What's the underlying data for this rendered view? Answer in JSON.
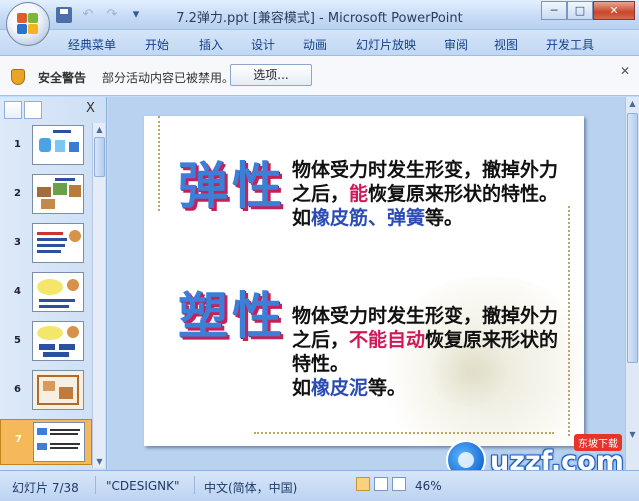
{
  "window": {
    "title": "7.2弹力.ppt [兼容模式] - Microsoft PowerPoint",
    "controls": [
      "─",
      "□",
      "✕"
    ]
  },
  "ribbon": {
    "tabs": [
      "经典菜单",
      "开始",
      "插入",
      "设计",
      "动画",
      "幻灯片放映",
      "审阅",
      "视图",
      "开发工具"
    ]
  },
  "security": {
    "title": "安全警告",
    "message": "部分活动内容已被禁用。",
    "options_button": "选项...",
    "close": "✕"
  },
  "left_panel": {
    "close": "X",
    "slides": [
      {
        "num": "1"
      },
      {
        "num": "2"
      },
      {
        "num": "3"
      },
      {
        "num": "4"
      },
      {
        "num": "5"
      },
      {
        "num": "6"
      },
      {
        "num": "7"
      }
    ],
    "selected_slide": 7
  },
  "slide": {
    "word1": "弹性",
    "para1_parts": {
      "a": "物体受力时发生形变，撤掉外力之后，",
      "b": "能",
      "c": "恢复原来形状的特性。",
      "d": "如",
      "e": "橡皮筋、弹簧",
      "f": "等。"
    },
    "word2": "塑性",
    "para2_parts": {
      "a": "物体受力时发生形变，撤掉外力之后，",
      "b": "不能自动",
      "c": "恢复原来形状的特性。",
      "d": "如",
      "e": "橡皮泥",
      "f": "等。"
    }
  },
  "status": {
    "slide_info": "幻灯片 7/38",
    "theme": "\"CDESIGNK\"",
    "language": "中文(简体，中国)",
    "zoom": "46%"
  },
  "watermark": {
    "text": "uzzf.com",
    "badge": "东坡下载"
  }
}
